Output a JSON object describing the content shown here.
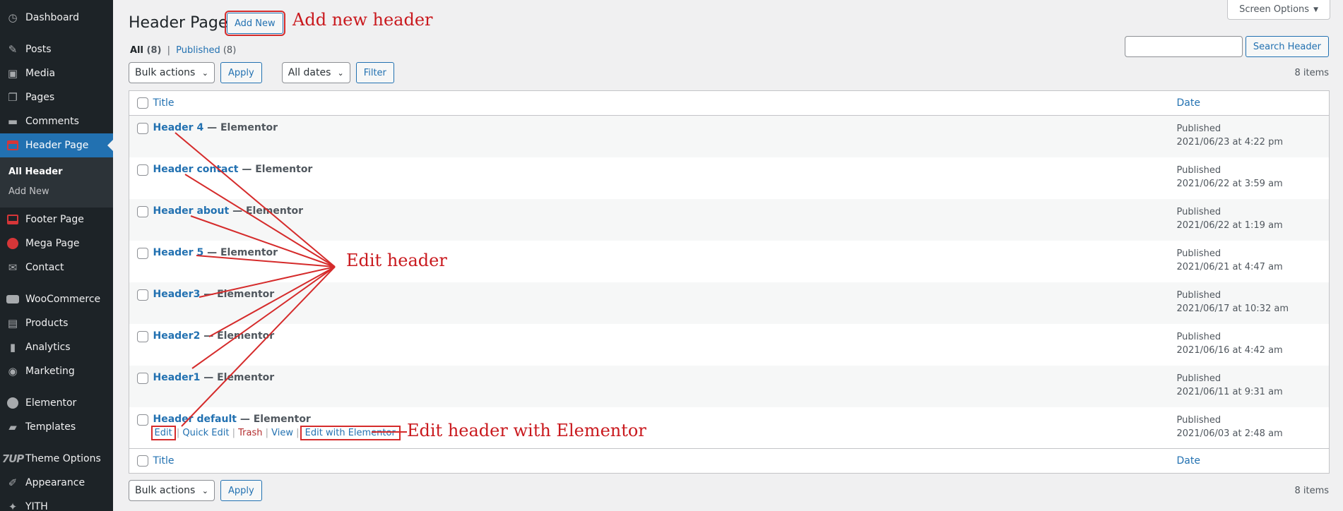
{
  "sidebar": {
    "items": [
      {
        "label": "Dashboard",
        "icon": "dashboard-icon"
      },
      {
        "label": "Posts",
        "icon": "pin-icon"
      },
      {
        "label": "Media",
        "icon": "media-icon"
      },
      {
        "label": "Pages",
        "icon": "pages-icon"
      },
      {
        "label": "Comments",
        "icon": "comments-icon"
      },
      {
        "label": "Header Page",
        "icon": "header-page-icon"
      },
      {
        "label": "Footer Page",
        "icon": "footer-page-icon"
      },
      {
        "label": "Mega Page",
        "icon": "mega-page-icon"
      },
      {
        "label": "Contact",
        "icon": "mail-icon"
      },
      {
        "label": "WooCommerce",
        "icon": "woocommerce-icon"
      },
      {
        "label": "Products",
        "icon": "archive-icon"
      },
      {
        "label": "Analytics",
        "icon": "bar-chart-icon"
      },
      {
        "label": "Marketing",
        "icon": "megaphone-icon"
      },
      {
        "label": "Elementor",
        "icon": "elementor-icon"
      },
      {
        "label": "Templates",
        "icon": "folder-icon"
      },
      {
        "label": "Theme Options",
        "icon": "7up-logo-icon",
        "logo_text": "7UP"
      },
      {
        "label": "Appearance",
        "icon": "brush-icon"
      },
      {
        "label": "YITH",
        "icon": "yith-icon"
      }
    ],
    "submenu": [
      {
        "label": "All Header"
      },
      {
        "label": "Add New"
      }
    ]
  },
  "header": {
    "title": "Header Page",
    "add_new": "Add New",
    "screen_options": "Screen Options"
  },
  "views": {
    "all": "All",
    "all_count": "(8)",
    "sep": "|",
    "published": "Published",
    "published_count": "(8)"
  },
  "search": {
    "button": "Search Header",
    "placeholder": ""
  },
  "tablenav": {
    "bulk_actions": "Bulk actions",
    "apply": "Apply",
    "all_dates": "All dates",
    "filter": "Filter",
    "items_count": "8 items"
  },
  "table": {
    "col_title": "Title",
    "col_date": "Date",
    "rows": [
      {
        "title": "Header 4",
        "suffix": " — Elementor",
        "status": "Published",
        "date": "2021/06/23 at 4:22 pm"
      },
      {
        "title": "Header contact",
        "suffix": " — Elementor",
        "status": "Published",
        "date": "2021/06/22 at 3:59 am"
      },
      {
        "title": "Header about",
        "suffix": " — Elementor",
        "status": "Published",
        "date": "2021/06/22 at 1:19 am"
      },
      {
        "title": "Header 5",
        "suffix": " — Elementor",
        "status": "Published",
        "date": "2021/06/21 at 4:47 am"
      },
      {
        "title": "Header3",
        "suffix": " — Elementor",
        "status": "Published",
        "date": "2021/06/17 at 10:32 am"
      },
      {
        "title": "Header2",
        "suffix": " — Elementor",
        "status": "Published",
        "date": "2021/06/16 at 4:42 am"
      },
      {
        "title": "Header1",
        "suffix": " — Elementor",
        "status": "Published",
        "date": "2021/06/11 at 9:31 am"
      },
      {
        "title": "Header default",
        "suffix": " — Elementor",
        "status": "Published",
        "date": "2021/06/03 at 2:48 am"
      }
    ],
    "row_actions": {
      "edit": "Edit",
      "quick_edit": "Quick Edit",
      "trash": "Trash",
      "view": "View",
      "edit_elementor": "Edit with Elementor",
      "sep": "|"
    }
  },
  "annotations": {
    "add_new_header": "Add new header",
    "edit_header": "Edit header",
    "edit_with_elementor": "Edit header with Elementor",
    "color": "#c9191e"
  },
  "colors": {
    "accent": "#2271b1",
    "sidebar_bg": "#1d2327",
    "annotation": "#d52b2b"
  }
}
